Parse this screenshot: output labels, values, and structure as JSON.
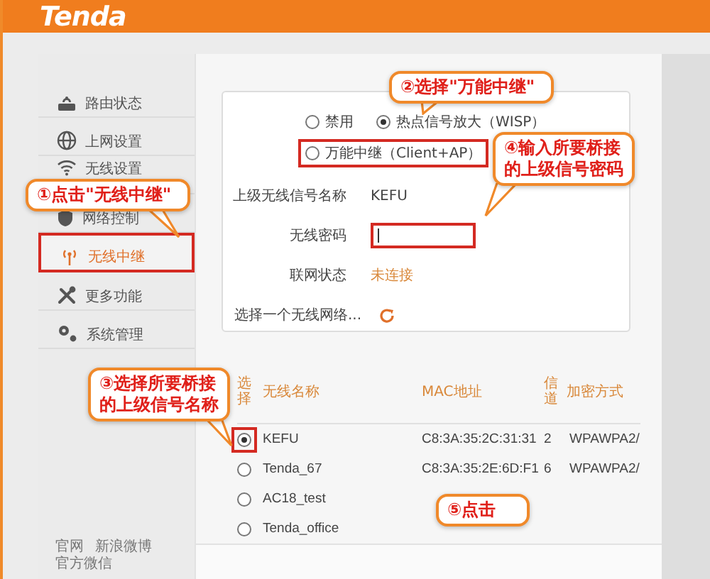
{
  "header": {
    "logo": "Tenda"
  },
  "sidebar": {
    "items": [
      {
        "label": "路由状态",
        "selected": false,
        "highlighted": false
      },
      {
        "label": "上网设置",
        "selected": false,
        "highlighted": false
      },
      {
        "label": "无线设置",
        "selected": false,
        "highlighted": false
      },
      {
        "label": "网络控制",
        "selected": false,
        "highlighted": false
      },
      {
        "label": "无线中继",
        "selected": true,
        "highlighted": true
      },
      {
        "label": "更多功能",
        "selected": false,
        "highlighted": false
      },
      {
        "label": "系统管理",
        "selected": false,
        "highlighted": false
      }
    ],
    "footer_links": [
      "官网",
      "新浪微博",
      "官方微信"
    ]
  },
  "repeater": {
    "modes": [
      {
        "label": "禁用",
        "selected": false,
        "highlighted": false
      },
      {
        "label": "热点信号放大（WISP）",
        "selected": true,
        "highlighted": false
      },
      {
        "label": "万能中继（Client+AP）",
        "selected": false,
        "highlighted": true
      }
    ],
    "fields": [
      {
        "kind": "text",
        "label": "上级无线信号名称",
        "value": "KEFU"
      },
      {
        "kind": "password",
        "label": "无线密码",
        "highlighted": true
      },
      {
        "kind": "status",
        "label": "联网状态",
        "value": "未连接"
      },
      {
        "kind": "refresh",
        "label": "选择一个无线网络..."
      }
    ]
  },
  "network_table": {
    "columns": [
      "选择",
      "无线名称",
      "MAC地址",
      "信道",
      "加密方式"
    ],
    "rows": [
      {
        "selected": true,
        "highlighted": true,
        "name": "KEFU",
        "mac": "C8:3A:35:2C:31:31",
        "channel": "2",
        "encryption": "WPAWPA2/"
      },
      {
        "selected": false,
        "highlighted": false,
        "name": "Tenda_67",
        "mac": "C8:3A:35:2E:6D:F1",
        "channel": "6",
        "encryption": "WPAWPA2/"
      },
      {
        "selected": false,
        "highlighted": false,
        "name": "AC18_test"
      },
      {
        "selected": false,
        "highlighted": false,
        "name": "Tenda_office"
      }
    ]
  },
  "callouts": [
    {
      "text": "①点击\"无线中继\""
    },
    {
      "text": "②选择\"万能中继\""
    },
    {
      "text": "③选择所要桥接的上级信号名称"
    },
    {
      "text": "④输入所要桥接的上级信号密码"
    },
    {
      "text": "⑤点击"
    }
  ]
}
